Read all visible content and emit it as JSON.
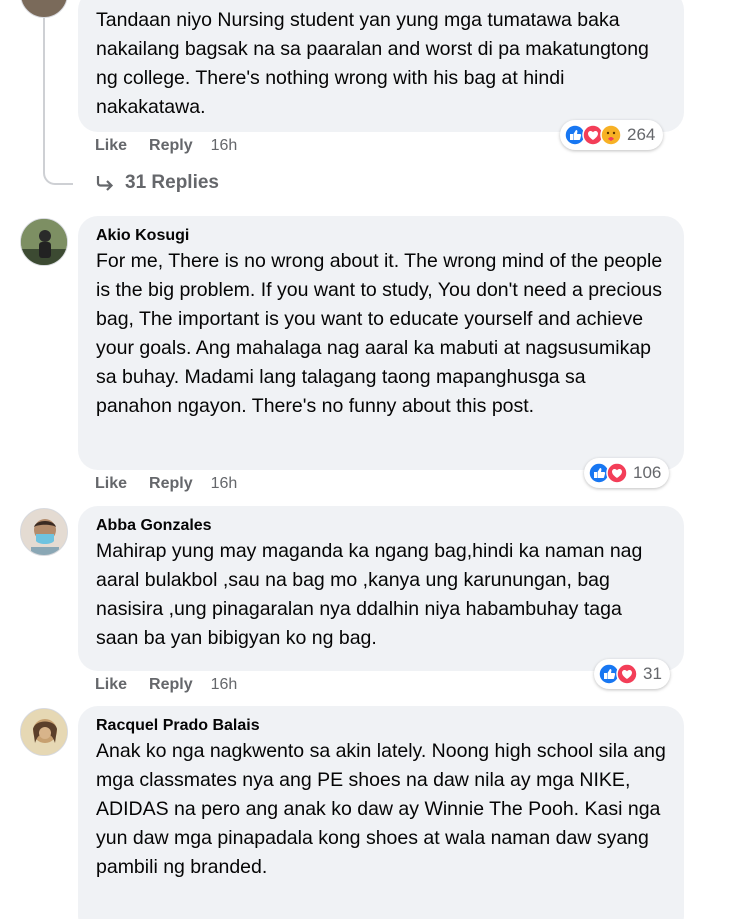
{
  "comments": [
    {
      "author": "",
      "text": "Tandaan niyo Nursing student yan yung mga tumatawa baka nakailang bagsak na sa paaralan and worst di pa makatungtong ng college. There's nothing wrong with his bag at hindi nakakatawa.",
      "like": "Like",
      "reply": "Reply",
      "time": "16h",
      "reaction_count": "264",
      "reactions": [
        "like-icon",
        "love-icon",
        "care-icon"
      ]
    },
    {
      "author": "Akio Kosugi",
      "text": "For me, There is no wrong about it. The wrong mind of the people is the big problem. If you want to study, You don't need a precious bag, The important is you want to educate yourself and achieve your goals. Ang mahalaga nag aaral ka mabuti at nagsusumikap sa buhay. Madami lang talagang taong mapanghusga sa panahon ngayon. There's no funny about this post.",
      "like": "Like",
      "reply": "Reply",
      "time": "16h",
      "reaction_count": "106",
      "reactions": [
        "like-icon",
        "love-icon"
      ]
    },
    {
      "author": "Abba Gonzales",
      "text": "Mahirap yung may maganda ka ngang bag,hindi ka naman nag aaral bulakbol ,sau na bag mo ,kanya ung karunungan, bag nasisira ,ung pinagaralan nya ddalhin niya habambuhay taga saan ba yan bibigyan ko ng bag.",
      "like": "Like",
      "reply": "Reply",
      "time": "16h",
      "reaction_count": "31",
      "reactions": [
        "like-icon",
        "love-icon"
      ]
    },
    {
      "author": "Racquel Prado Balais",
      "text": "Anak ko nga nagkwento sa akin lately. Noong high school sila ang mga classmates nya ang PE shoes na daw nila ay mga NIKE, ADIDAS na pero ang anak ko daw ay Winnie The Pooh. Kasi nga yun daw mga pinapadala kong shoes at wala naman daw syang pambili ng branded."
    }
  ],
  "replies_label": "31 Replies",
  "colors": {
    "like": "#1877f2",
    "love": "#f33e58",
    "care": "#f7b125",
    "bubble": "#f0f2f5",
    "meta": "#65676b"
  }
}
